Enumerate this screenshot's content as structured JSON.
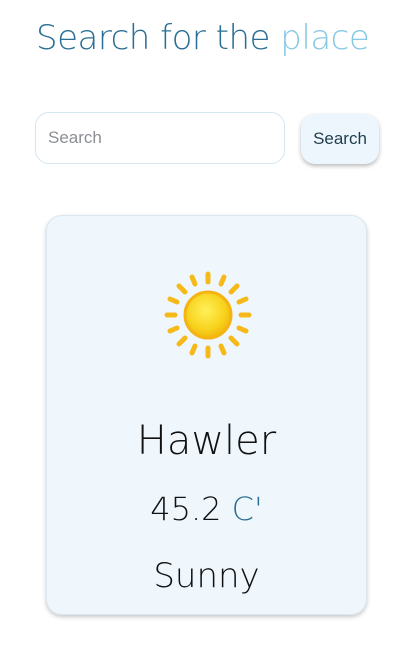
{
  "header": {
    "title_main": "Search for the",
    "title_accent": "place",
    "colors": {
      "main": "#2a6f93",
      "accent": "#86c9e3"
    }
  },
  "search": {
    "placeholder": "Search",
    "value": "",
    "button_label": "Search"
  },
  "weather": {
    "icon": "sun-icon",
    "city": "Hawler",
    "temperature": "45.2",
    "unit": "C'",
    "condition": "Sunny",
    "card_color": "#eff7fd"
  }
}
